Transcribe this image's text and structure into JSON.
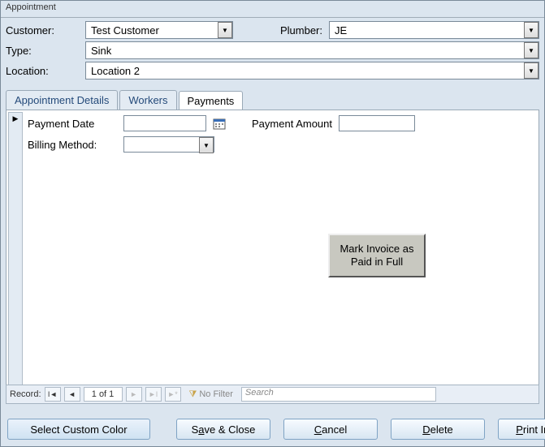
{
  "window": {
    "title": "Appointment"
  },
  "header": {
    "customer_label": "Customer:",
    "customer_value": "Test Customer",
    "plumber_label": "Plumber:",
    "plumber_value": "JE",
    "type_label": "Type:",
    "type_value": "Sink",
    "location_label": "Location:",
    "location_value": "Location 2"
  },
  "tabs": {
    "details": "Appointment Details",
    "workers": "Workers",
    "payments": "Payments"
  },
  "payments": {
    "payment_date_label": "Payment Date",
    "payment_date_value": "",
    "payment_amount_label": "Payment Amount",
    "payment_amount_value": "",
    "billing_method_label": "Billing Method:",
    "billing_method_value": "",
    "paid_button_line1": "Mark Invoice as",
    "paid_button_line2": "Paid in Full"
  },
  "recordnav": {
    "label": "Record:",
    "position": "1 of 1",
    "nofilter": "No Filter",
    "search_placeholder": "Search"
  },
  "footer": {
    "custom_color": "Select Custom Color",
    "save_close_pre": "S",
    "save_close_u": "a",
    "save_close_post": "ve & Close",
    "cancel_u": "C",
    "cancel_post": "ancel",
    "delete_u": "D",
    "delete_post": "elete",
    "print_u": "P",
    "print_post": "rint Invoice"
  }
}
